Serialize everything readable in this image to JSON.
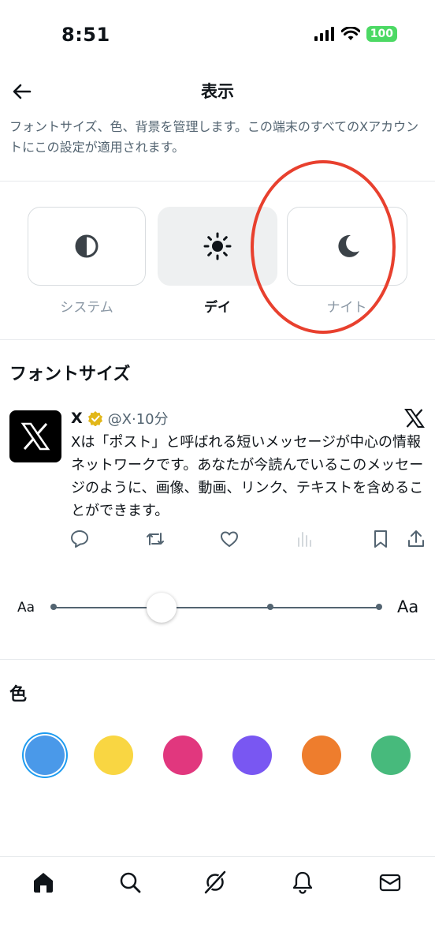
{
  "status_bar": {
    "time": "8:51",
    "battery": "100"
  },
  "header": {
    "title": "表示"
  },
  "description": "フォントサイズ、色、背景を管理します。この端末のすべてのXアカウントにこの設定が適用されます。",
  "themes": [
    {
      "label": "システム",
      "icon": "half-circle-icon",
      "selected": false
    },
    {
      "label": "デイ",
      "icon": "sun-icon",
      "selected": true
    },
    {
      "label": "ナイト",
      "icon": "moon-icon",
      "selected": false
    }
  ],
  "font_size": {
    "heading": "フォントサイズ",
    "small_label": "Aa",
    "large_label": "Aa",
    "level_fraction": 0.33
  },
  "tweet": {
    "name": "X",
    "handle_time": "@X·10分",
    "body": "Xは「ポスト」と呼ばれる短いメッセージが中心の情報ネットワークです。あなたが今読んでいるこのメッセージのように、画像、動画、リンク、テキストを含めることができます。"
  },
  "color_section": {
    "heading": "色",
    "swatches": [
      "#4a99e9",
      "#f9d642",
      "#e1377e",
      "#7957f2",
      "#ee7d2d",
      "#47ba7c"
    ],
    "selected_index": 0
  }
}
